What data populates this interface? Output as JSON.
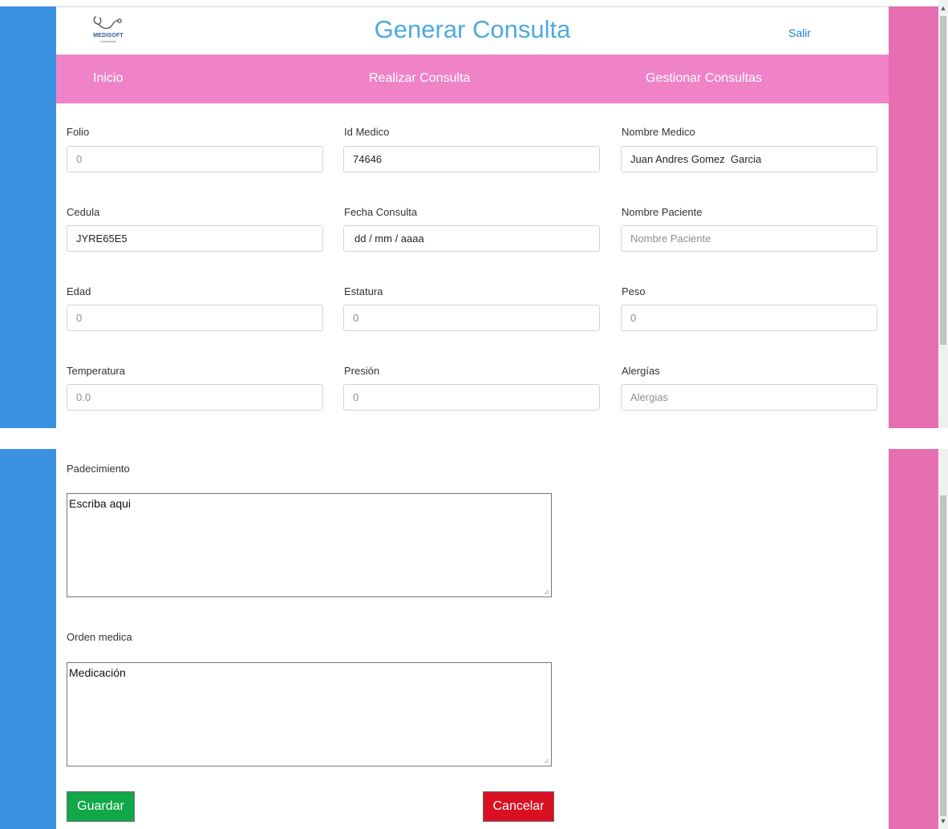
{
  "header": {
    "logo_text": "MEDISOFT",
    "logo_subtext": "Consultorio",
    "title": "Generar Consulta",
    "logout_label": "Salir"
  },
  "nav": {
    "items": [
      {
        "label": "Inicio"
      },
      {
        "label": "Realizar Consulta"
      },
      {
        "label": "Gestionar Consultas"
      }
    ]
  },
  "form": {
    "folio": {
      "label": "Folio",
      "value": "0"
    },
    "id_medico": {
      "label": "Id Medico",
      "value": "74646"
    },
    "nombre_medico": {
      "label": "Nombre Medico",
      "value": "Juan Andres Gomez  Garcia"
    },
    "cedula": {
      "label": "Cedula",
      "value": "JYRE65E5"
    },
    "fecha_consulta": {
      "label": "Fecha Consulta",
      "value": "dd / mm / aaaa"
    },
    "nombre_paciente": {
      "label": "Nombre Paciente",
      "placeholder": "Nombre Paciente"
    },
    "edad": {
      "label": "Edad",
      "value": "0"
    },
    "estatura": {
      "label": "Estatura",
      "value": "0"
    },
    "peso": {
      "label": "Peso",
      "value": "0"
    },
    "temperatura": {
      "label": "Temperatura",
      "value": "0.0"
    },
    "presion": {
      "label": "Presión",
      "value": "0"
    },
    "alergias": {
      "label": "Alergías",
      "placeholder": "Alergias"
    },
    "padecimiento": {
      "label": "Padecimiento",
      "value": "Escriba aqui"
    },
    "orden_medica": {
      "label": "Orden medica",
      "value": "Medicación"
    }
  },
  "buttons": {
    "save_label": "Guardar",
    "cancel_label": "Cancelar"
  },
  "colors": {
    "left_band": "#3b92e3",
    "right_band": "#e56fb0",
    "navbar": "#f083c7",
    "title": "#4fa9de",
    "save": "#11a84a",
    "cancel": "#da1022"
  }
}
